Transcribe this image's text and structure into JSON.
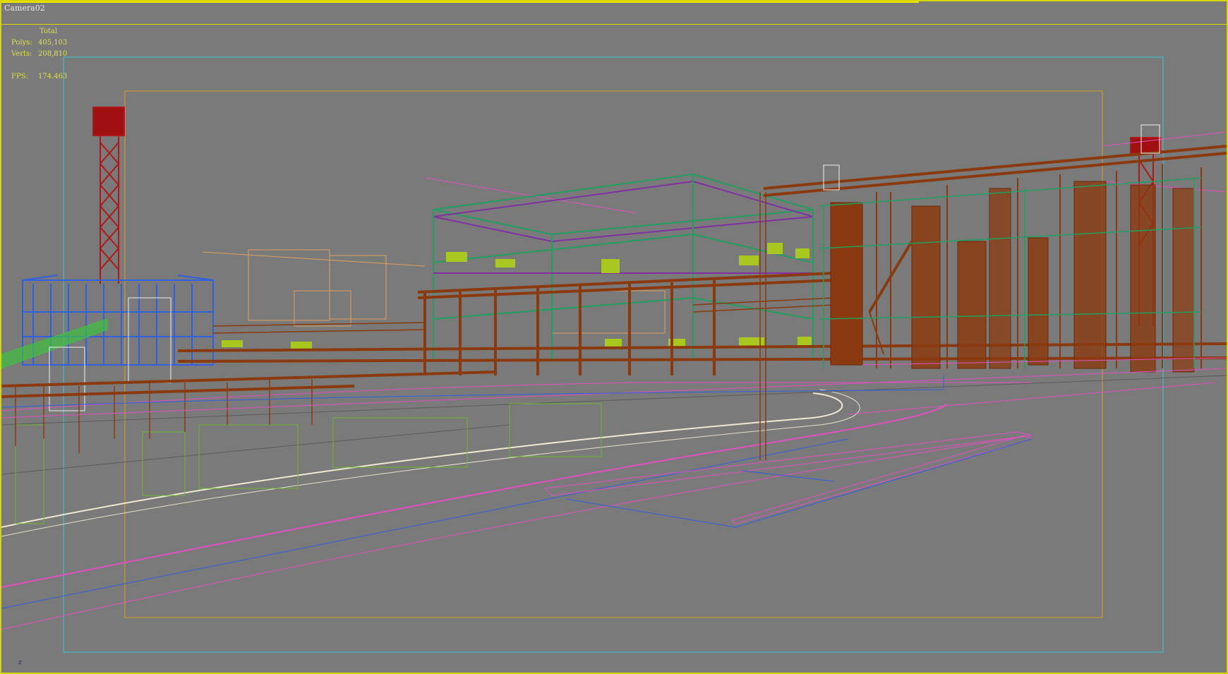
{
  "viewport": {
    "camera_label": "Camera02",
    "stats": {
      "header": "Total",
      "polys_label": "Polys:",
      "polys_value": "405,103",
      "verts_label": "Verts:",
      "verts_value": "208,810",
      "fps_label": "FPS:",
      "fps_value": "174.463"
    },
    "axis_label": "z"
  },
  "colors": {
    "background": "#7a7a7a",
    "active_border": "#d8d800",
    "safe_frame_outer": "#38c8d8",
    "safe_frame_inner": "#d8a020",
    "pipe": "#8b3a0f",
    "green": "#20a060",
    "magenta": "#e050c0",
    "blue": "#3060e0",
    "lime": "#a8c820",
    "tower": "#b01818"
  }
}
